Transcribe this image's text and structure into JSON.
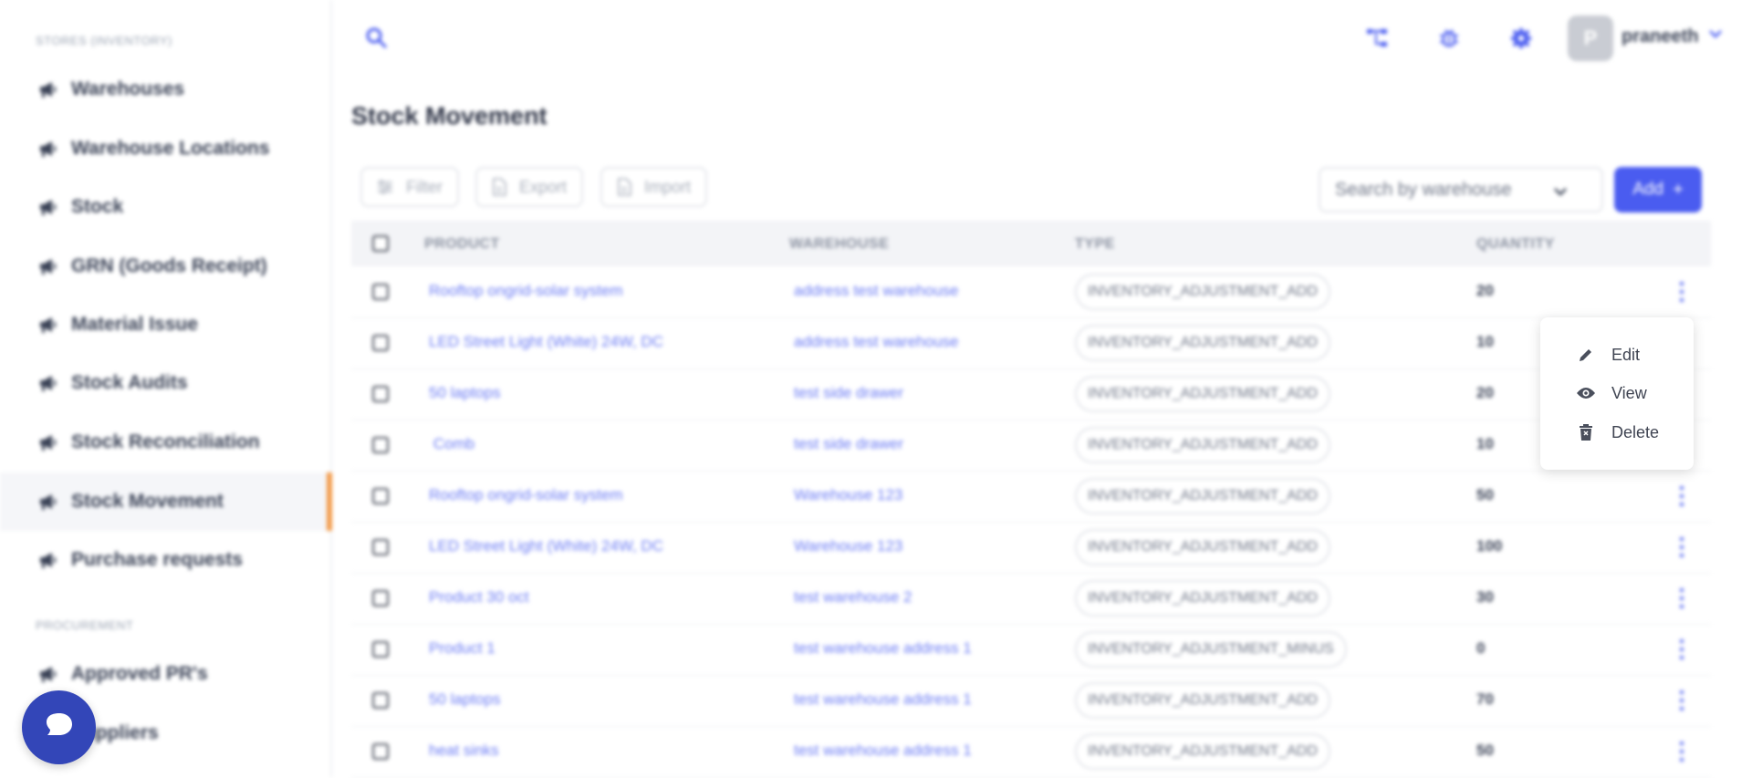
{
  "sidebar": {
    "section_inventory": "STORES (INVENTORY)",
    "section_procurement": "PROCUREMENT",
    "items": [
      {
        "label": "Warehouses",
        "icon": "megaphone-icon"
      },
      {
        "label": "Warehouse Locations",
        "icon": "megaphone-icon"
      },
      {
        "label": "Stock",
        "icon": "megaphone-icon"
      },
      {
        "label": "GRN (Goods Receipt)",
        "icon": "megaphone-icon"
      },
      {
        "label": "Material Issue",
        "icon": "megaphone-icon"
      },
      {
        "label": "Stock Audits",
        "icon": "megaphone-icon"
      },
      {
        "label": "Stock Reconciliation",
        "icon": "megaphone-icon"
      },
      {
        "label": "Stock Movement",
        "icon": "megaphone-icon",
        "active": true
      },
      {
        "label": "Purchase requests",
        "icon": "megaphone-icon"
      }
    ],
    "procurement_items": [
      {
        "label": "Approved PR's",
        "icon": "megaphone-icon"
      },
      {
        "label": "Suppliers",
        "icon": "megaphone-icon"
      }
    ]
  },
  "topbar": {
    "search_icon": "search-icon",
    "icons": [
      "hierarchy-icon",
      "bug-icon",
      "gear-icon"
    ],
    "avatar_initial": "P",
    "username": "praneeth"
  },
  "page": {
    "title": "Stock Movement",
    "toolbar": {
      "filter": "Filter",
      "export": "Export",
      "import": "Import"
    },
    "warehouse_select_placeholder": "Search by warehouse",
    "add_label": "Add",
    "add_symbol": "+"
  },
  "table": {
    "headers": {
      "product": "PRODUCT",
      "warehouse": "WAREHOUSE",
      "type": "TYPE",
      "quantity": "QUANTITY"
    },
    "rows": [
      {
        "product": "Rooftop ongrid-solar system",
        "warehouse": "address test warehouse",
        "type": "INVENTORY_ADJUSTMENT_ADD",
        "quantity": "20"
      },
      {
        "product": "LED Street Light (White) 24W, DC",
        "warehouse": "address test warehouse",
        "type": "INVENTORY_ADJUSTMENT_ADD",
        "quantity": "10"
      },
      {
        "product": "50 laptops",
        "warehouse": "test side drawer",
        "type": "INVENTORY_ADJUSTMENT_ADD",
        "quantity": "20"
      },
      {
        "product": " Comb",
        "warehouse": "test side drawer",
        "type": "INVENTORY_ADJUSTMENT_ADD",
        "quantity": "10"
      },
      {
        "product": "Rooftop ongrid-solar system",
        "warehouse": "Warehouse 123",
        "type": "INVENTORY_ADJUSTMENT_ADD",
        "quantity": "50"
      },
      {
        "product": "LED Street Light (White) 24W, DC",
        "warehouse": "Warehouse 123",
        "type": "INVENTORY_ADJUSTMENT_ADD",
        "quantity": "100"
      },
      {
        "product": "Product 30 oct",
        "warehouse": "test warehouse 2",
        "type": "INVENTORY_ADJUSTMENT_ADD",
        "quantity": "30"
      },
      {
        "product": "Product 1",
        "warehouse": "test warehouse address 1",
        "type": "INVENTORY_ADJUSTMENT_MINUS",
        "quantity": "0"
      },
      {
        "product": "50 laptops",
        "warehouse": "test warehouse address 1",
        "type": "INVENTORY_ADJUSTMENT_ADD",
        "quantity": "70"
      },
      {
        "product": "heat sinks",
        "warehouse": "test warehouse address 1",
        "type": "INVENTORY_ADJUSTMENT_ADD",
        "quantity": "50"
      }
    ]
  },
  "context_menu": {
    "items": [
      {
        "label": "Edit",
        "icon": "pencil-icon"
      },
      {
        "label": "View",
        "icon": "eye-icon"
      },
      {
        "label": "Delete",
        "icon": "trash-icon"
      }
    ]
  },
  "colors": {
    "accent": "#4a5cf0",
    "active_marker": "#f29a4a",
    "link": "#6c7cf4",
    "chat": "#3346b8"
  }
}
